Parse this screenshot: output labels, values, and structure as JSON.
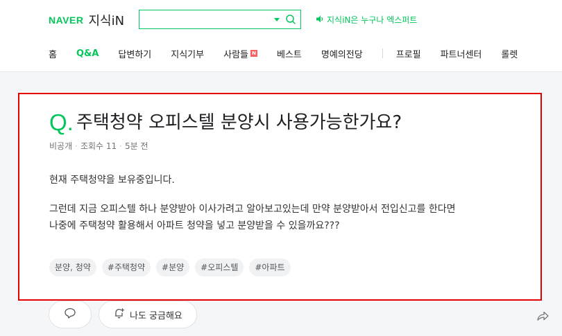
{
  "header": {
    "logo_naver": "NAVER",
    "logo_service": "지식iN",
    "search": {
      "placeholder": "",
      "value": ""
    },
    "promo_text": "지식iN은 누구나 엑스퍼트"
  },
  "nav": {
    "items": [
      {
        "label": "홈"
      },
      {
        "label": "Q&A",
        "active": true
      },
      {
        "label": "답변하기"
      },
      {
        "label": "지식기부"
      },
      {
        "label": "사람들",
        "badge": "N"
      },
      {
        "label": "베스트"
      },
      {
        "label": "명예의전당"
      },
      {
        "label": "프로필"
      },
      {
        "label": "파트너센터"
      },
      {
        "label": "롤렛"
      }
    ]
  },
  "question": {
    "q_mark": "Q.",
    "title": "주택청약 오피스텔 분양시 사용가능한가요?",
    "meta": {
      "author": "비공개",
      "views": "조회수 11",
      "time": "5분 전"
    },
    "body": [
      "현재 주택청약을 보유중입니다.",
      "그런데 지금 오피스텔 하나 분양받아 이사가려고 알아보고있는데 만약 분양받아서 전입신고를 한다면",
      "나중에 주택청약 활용해서 아파트 청약을 넣고 분양받을 수 있을까요???"
    ],
    "tags": [
      "분양, 청약",
      "#주택청약",
      "#분양",
      "#오피스텔",
      "#아파트"
    ]
  },
  "actions": {
    "curious_label": "나도 궁금해요"
  },
  "colors": {
    "brand": "#03c75a",
    "highlight_border": "#e50000"
  },
  "icons": [
    "search-icon",
    "speaker-icon",
    "comment-icon",
    "bell-icon",
    "share-icon"
  ]
}
